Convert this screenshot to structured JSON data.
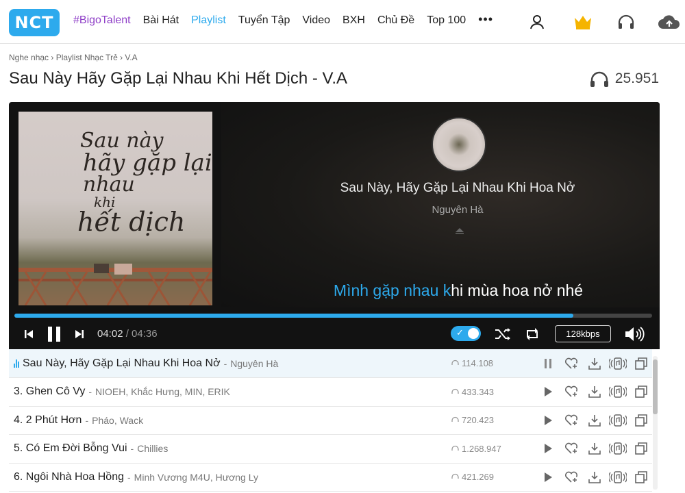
{
  "header": {
    "logo": "NCT",
    "nav": [
      "#BigoTalent",
      "Bài Hát",
      "Playlist",
      "Tuyển Tập",
      "Video",
      "BXH",
      "Chủ Đề",
      "Top 100"
    ],
    "more": "•••",
    "icons": [
      "user-icon",
      "crown-icon",
      "headphones-icon",
      "cloud-upload-icon"
    ]
  },
  "breadcrumb": "Nghe nhạc › Playlist Nhạc Trẻ › V.A",
  "page": {
    "title": "Sau Này Hãy Gặp Lại Nhau Khi Hết Dịch - V.A",
    "listen_count": "25.951"
  },
  "cover": {
    "text_lines": [
      "Sau này",
      "hãy gặp lại",
      "nhau",
      "khi",
      "hết dịch"
    ]
  },
  "player": {
    "song_title": "Sau Này, Hãy Gặp Lại Nhau Khi Hoa Nở",
    "artist": "Nguyên Hà",
    "lyric_sung": "Mình gặp nhau k",
    "lyric_rest": "hi mùa hoa nở nhé",
    "current_time": "04:02",
    "total_time": "/ 04:36",
    "progress": 0.876,
    "quality": "128kbps",
    "autoplay_on": true,
    "accent_color": "#2daaed"
  },
  "songs": [
    {
      "index": "",
      "name": "Sau Này, Hãy Gặp Lại Nhau Khi Hoa Nở",
      "artists": "Nguyên Hà",
      "plays": "114.108",
      "playing": true
    },
    {
      "index": "3.",
      "name": "Ghen Cô Vy",
      "artists": "NIOEH,  Khắc Hưng,  MIN,  ERIK",
      "plays": "433.343",
      "playing": false
    },
    {
      "index": "4.",
      "name": "2 Phút Hơn",
      "artists": "Pháo,  Wack",
      "plays": "720.423",
      "playing": false
    },
    {
      "index": "5.",
      "name": "Có Em Đời Bỗng Vui",
      "artists": "Chillies",
      "plays": "1.268.947",
      "playing": false
    },
    {
      "index": "6.",
      "name": "Ngôi Nhà Hoa Hồng",
      "artists": "Minh Vương M4U,  Hương Ly",
      "plays": "421.269",
      "playing": false
    }
  ],
  "dash": "-"
}
